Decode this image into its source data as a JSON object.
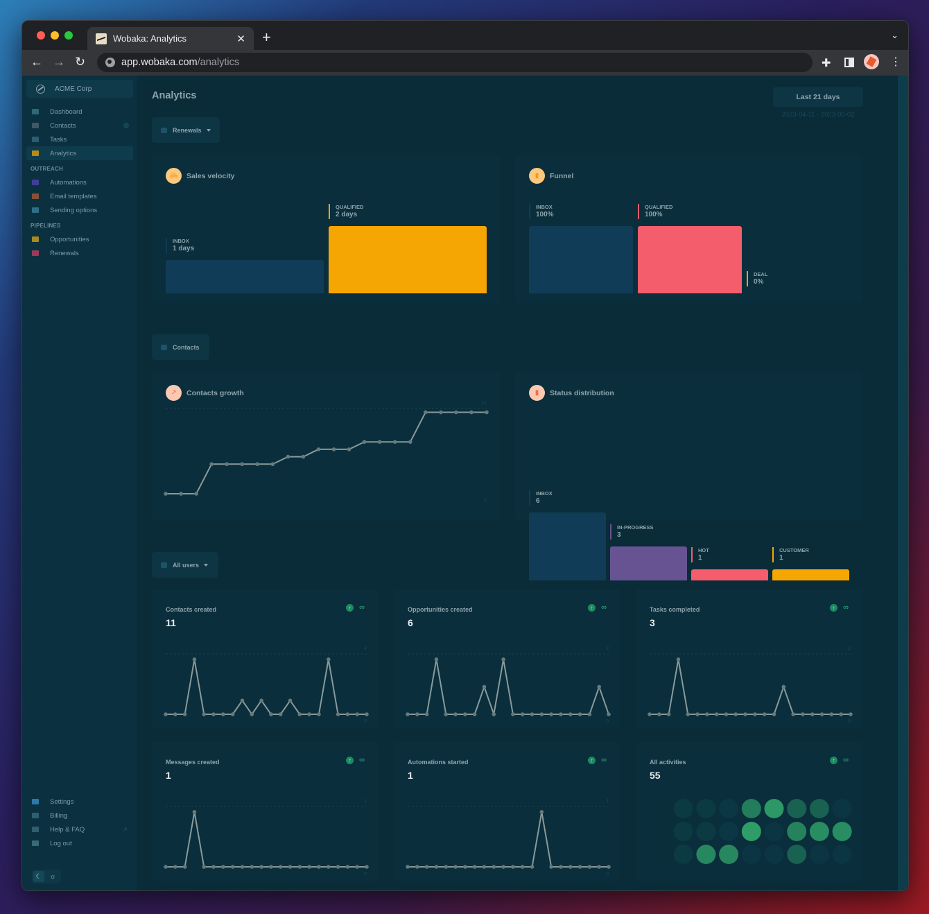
{
  "browser": {
    "tab_title": "Wobaka: Analytics",
    "url_host": "app.wobaka.com",
    "url_path": "/analytics",
    "icons": {
      "back": "arrow-left-icon",
      "forward": "arrow-right-icon",
      "reload": "reload-icon",
      "extensions": "puzzle-icon",
      "side_panel": "side-panel-icon",
      "menu": "kebab-menu-icon"
    }
  },
  "sidebar": {
    "org": "ACME Corp",
    "items": [
      {
        "label": "Dashboard",
        "icon": "home-icon",
        "color": "#2c6a78"
      },
      {
        "label": "Contacts",
        "icon": "contacts-card-icon",
        "color": "#3d5a66",
        "badge": true
      },
      {
        "label": "Tasks",
        "icon": "tasks-list-icon",
        "color": "#2a5e70"
      },
      {
        "label": "Analytics",
        "icon": "analytics-chart-icon",
        "color": "#b58a1c",
        "active": true
      }
    ],
    "sections": [
      {
        "label": "OUTREACH",
        "items": [
          {
            "label": "Automations",
            "icon": "paper-plane-icon",
            "color": "#3f3f9a"
          },
          {
            "label": "Email templates",
            "icon": "envelope-icon",
            "color": "#8a4e38"
          },
          {
            "label": "Sending options",
            "icon": "gears-icon",
            "color": "#2f6f86"
          }
        ]
      },
      {
        "label": "PIPELINES",
        "items": [
          {
            "label": "Opportunities",
            "icon": "layers-icon",
            "color": "#a88a20"
          },
          {
            "label": "Renewals",
            "icon": "layers-icon",
            "color": "#9a3a5a"
          }
        ]
      }
    ],
    "bottom": [
      {
        "label": "Settings",
        "icon": "settings-icon",
        "color": "#2a7aa8"
      },
      {
        "label": "Billing",
        "icon": "credit-card-icon",
        "color": "#2f5f6e"
      },
      {
        "label": "Help & FAQ",
        "icon": "lifebuoy-icon",
        "color": "#2f5f6e",
        "external": true
      },
      {
        "label": "Log out",
        "icon": "logout-icon",
        "color": "#3a6a78"
      }
    ],
    "theme": {
      "dark": "moon-icon",
      "light": "sun-icon",
      "selected": "dark"
    }
  },
  "main": {
    "title": "Analytics",
    "range_button": "Last 21 days",
    "range_dates": "2023-04-11 - 2023-05-02",
    "pipeline_filter": "Renewals",
    "contacts_filter": "Contacts",
    "users_filter": "All users"
  },
  "colors": {
    "inbox": "#113c58",
    "qualified_velocity": "#f6a603",
    "qualified_funnel": "#f45d6c",
    "deal": "#f6a603",
    "in_progress": "#685392",
    "hot": "#f45d6c",
    "customer": "#f6a603",
    "line": "#8a9a9c",
    "point": "#657a7c"
  },
  "chart_data": [
    {
      "id": "sales_velocity",
      "type": "bar",
      "title": "Sales velocity",
      "categories": [
        "INBOX",
        "QUALIFIED"
      ],
      "values": [
        1,
        2
      ],
      "value_labels": [
        "1 days",
        "2 days"
      ],
      "unit": "days"
    },
    {
      "id": "funnel",
      "type": "bar",
      "title": "Funnel",
      "categories": [
        "INBOX",
        "QUALIFIED",
        "DEAL"
      ],
      "values": [
        100,
        100,
        0
      ],
      "value_labels": [
        "100%",
        "100%",
        "0%"
      ],
      "unit": "%"
    },
    {
      "id": "contacts_growth",
      "type": "line",
      "title": "Contacts growth",
      "values": [
        0,
        0,
        0,
        4,
        4,
        4,
        4,
        4,
        5,
        5,
        6,
        6,
        6,
        7,
        7,
        7,
        7,
        11,
        11,
        11,
        11,
        11
      ],
      "ylim": [
        0,
        11
      ],
      "ytick_labels": [
        "0",
        "11"
      ],
      "grid": true
    },
    {
      "id": "status_distribution",
      "type": "bar",
      "title": "Status distribution",
      "categories": [
        "INBOX",
        "IN-PROGRESS",
        "HOT",
        "CUSTOMER"
      ],
      "values": [
        6,
        3,
        1,
        1
      ],
      "value_labels": [
        "6",
        "3",
        "1",
        "1"
      ]
    },
    {
      "id": "contacts_created",
      "type": "line",
      "title": "Contacts created",
      "total": "11",
      "trend": "∞",
      "values": [
        0,
        0,
        0,
        4,
        0,
        0,
        0,
        0,
        1,
        0,
        1,
        0,
        0,
        1,
        0,
        0,
        0,
        4,
        0,
        0,
        0,
        0
      ],
      "ylim": [
        0,
        4
      ],
      "ytick_labels": [
        "0",
        "4"
      ]
    },
    {
      "id": "opportunities_created",
      "type": "line",
      "title": "Opportunities created",
      "total": "6",
      "trend": "∞",
      "values": [
        0,
        0,
        0,
        2,
        0,
        0,
        0,
        0,
        1,
        0,
        2,
        0,
        0,
        0,
        0,
        0,
        0,
        0,
        0,
        0,
        1,
        0
      ],
      "ylim": [
        0,
        2
      ],
      "ytick_labels": [
        "0",
        "2"
      ]
    },
    {
      "id": "tasks_completed",
      "type": "line",
      "title": "Tasks completed",
      "total": "3",
      "trend": "∞",
      "values": [
        0,
        0,
        0,
        2,
        0,
        0,
        0,
        0,
        0,
        0,
        0,
        0,
        0,
        0,
        1,
        0,
        0,
        0,
        0,
        0,
        0,
        0
      ],
      "ylim": [
        0,
        2
      ],
      "ytick_labels": [
        "0",
        "2"
      ]
    },
    {
      "id": "messages_created",
      "type": "line",
      "title": "Messages created",
      "total": "1",
      "trend": "∞",
      "values": [
        0,
        0,
        0,
        1,
        0,
        0,
        0,
        0,
        0,
        0,
        0,
        0,
        0,
        0,
        0,
        0,
        0,
        0,
        0,
        0,
        0,
        0
      ],
      "ylim": [
        0,
        1
      ],
      "ytick_labels": [
        "0",
        "1"
      ]
    },
    {
      "id": "automations_started",
      "type": "line",
      "title": "Automations started",
      "total": "1",
      "trend": "∞",
      "values": [
        0,
        0,
        0,
        0,
        0,
        0,
        0,
        0,
        0,
        0,
        0,
        0,
        0,
        0,
        1,
        0,
        0,
        0,
        0,
        0,
        0,
        0
      ],
      "ylim": [
        0,
        1
      ],
      "ytick_labels": [
        "0",
        "1"
      ]
    },
    {
      "id": "all_activities",
      "type": "heatmap",
      "title": "All activities",
      "total": "55",
      "trend": "∞",
      "rows": 3,
      "cols": 9,
      "intensity": [
        [
          0.0,
          0.1,
          0.1,
          0.0,
          0.6,
          0.85,
          0.35,
          0.35,
          0.0
        ],
        [
          0.0,
          0.1,
          0.1,
          0.0,
          0.9,
          0.0,
          0.65,
          0.75,
          0.75
        ],
        [
          0.0,
          0.1,
          0.7,
          0.7,
          0.0,
          0.0,
          0.35,
          0.0,
          0.0
        ]
      ]
    }
  ]
}
